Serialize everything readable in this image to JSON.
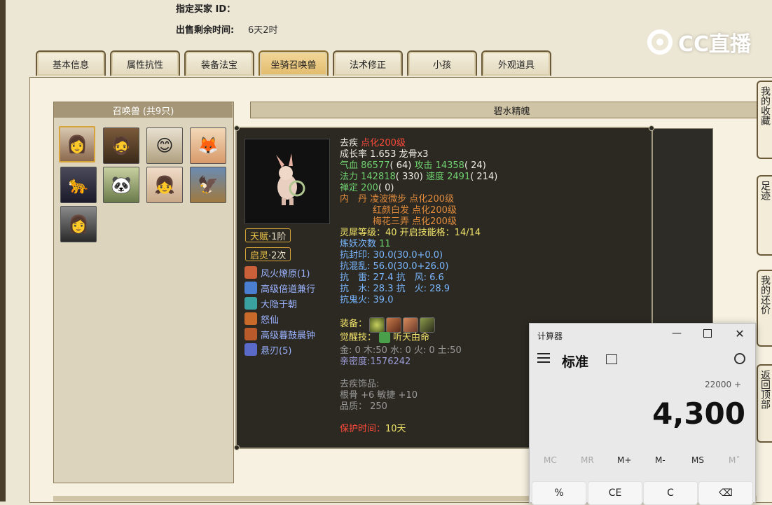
{
  "header": {
    "buyer_label": "指定买家 ID：",
    "time_label": "出售剩余时间:",
    "time_value": "6天2时"
  },
  "watermark": "CC直播",
  "tabs": [
    "基本信息",
    "属性抗性",
    "装备法宝",
    "坐骑召唤兽",
    "法术修正",
    "小孩",
    "外观道具"
  ],
  "active_tab": 3,
  "list_panel": {
    "title": "召唤兽 (共9只)"
  },
  "pet_name": "碧水精魄",
  "right_tabs": [
    "我的收藏",
    "足迹",
    "我的还价",
    "返回顶部"
  ],
  "popup": {
    "badges": [
      {
        "name": "天赋",
        "rank": "·1阶"
      },
      {
        "name": "启灵",
        "rank": "·2次"
      }
    ],
    "skills": [
      "风火燎原(1)",
      "高级倍道兼行",
      "大隐于朝",
      "怒仙",
      "高级暮鼓晨钟",
      "悬刃(5)"
    ],
    "skill_colors": [
      "#c9603a",
      "#4a7ed0",
      "#3aa0a0",
      "#c86a2a",
      "#b85a2a",
      "#5a6ac8"
    ],
    "lines": {
      "l1a": "去疾 ",
      "l1b": "点化200级",
      "l2": "成长率 1.653 龙骨x3",
      "l3a": "气血 86577",
      "l3b": "( 64) ",
      "l3c": "攻击 14358",
      "l3d": "( 24)",
      "l4a": "法力 142818",
      "l4b": "( 330) ",
      "l4c": "速度 2491",
      "l4d": "( 214)",
      "l5a": "禅定 200",
      "l5b": "( 0)",
      "l6": "内　丹 凌波微步 点化200级",
      "l7": "红颜白发 点化200级",
      "l8": "梅花三弄 点化200级",
      "l9": "灵犀等级：40 开启技能格：14/14",
      "l10a": "炼妖次数",
      "l10b": " 11",
      "l11a": "抗封印: ",
      "l11b": "30.0(30.0+0.0)",
      "l12a": "抗混乱: ",
      "l12b": "56.0(30.0+26.0)",
      "l13a": "抗　雷: ",
      "l13b": "27.4 ",
      "l13c": "抗　风: ",
      "l13d": "6.6",
      "l14a": "抗　水: ",
      "l14b": "28.3 ",
      "l14c": "抗　火: ",
      "l14d": "28.9",
      "l15a": "抗鬼火: ",
      "l15b": "39.0",
      "l16": "装备：",
      "l17a": "觉醒技：",
      "l17b": "听天由命",
      "l18": "金: 0 木:50 水: 0 火: 0 土:50",
      "l19": "亲密度:1576242",
      "l20": "去疾饰品:",
      "l21": "根骨 +6 敏捷 +10",
      "l22": "品质： 250",
      "l23a": "保护时间：",
      "l23b": "10天"
    }
  },
  "calculator": {
    "title": "计算器",
    "mode": "标准",
    "expression": "22000 +",
    "display": "4,300",
    "memory": [
      "MC",
      "MR",
      "M+",
      "M-",
      "MS",
      "M˅"
    ],
    "keys": [
      "%",
      "CE",
      "C",
      "⌫"
    ]
  },
  "colors": {
    "accent_gold": "#d8a43a",
    "popup_bg": "#2b2922"
  }
}
